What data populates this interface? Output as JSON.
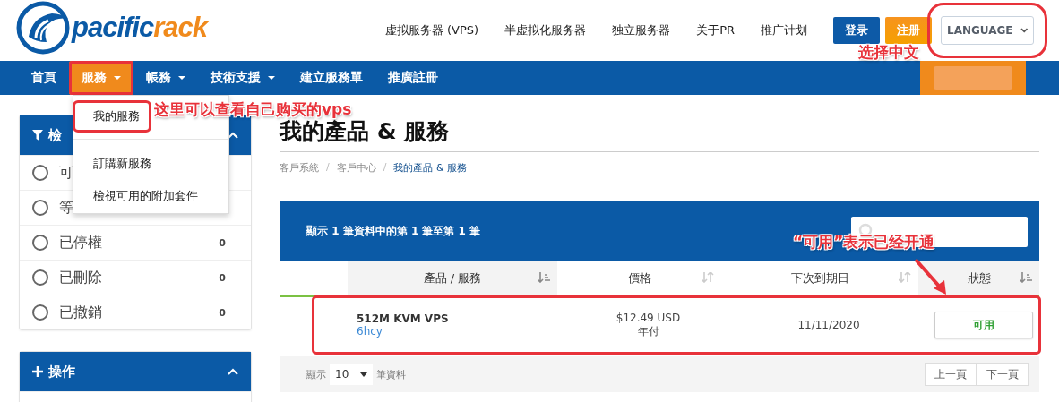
{
  "logo": {
    "part_1": "pacific",
    "part_2": "rack"
  },
  "top_links": [
    "虚拟服务器 (VPS)",
    "半虚拟化服务器",
    "独立服务器",
    "关于PR",
    "推广计划"
  ],
  "top_buttons": [
    {
      "label": "登录",
      "kind": "primary"
    },
    {
      "label": "注册",
      "kind": "warning"
    }
  ],
  "language_select": {
    "value": "LANGUAGE",
    "highlighted": true
  },
  "nav": {
    "items": [
      {
        "label": "首頁",
        "dropdown": false,
        "selected": false,
        "highlighted": false
      },
      {
        "label": "服務",
        "dropdown": true,
        "selected": true,
        "highlighted": true
      },
      {
        "label": "帳務",
        "dropdown": true,
        "selected": false,
        "highlighted": false
      },
      {
        "label": "技術支援",
        "dropdown": true,
        "selected": false,
        "highlighted": false
      },
      {
        "label": "建立服務單",
        "dropdown": false,
        "selected": false,
        "highlighted": false
      },
      {
        "label": "推廣註冊",
        "dropdown": false,
        "selected": false,
        "highlighted": false
      }
    ]
  },
  "dropdown_menu": {
    "items": [
      {
        "kind": "item",
        "label": "我的服務",
        "highlighted": true
      },
      {
        "kind": "divider"
      },
      {
        "kind": "item",
        "label": "訂購新服務",
        "highlighted": false
      },
      {
        "kind": "item",
        "label": "檢視可用的附加套件",
        "highlighted": false
      }
    ]
  },
  "sidebar": {
    "filter_panel": {
      "title": "檢",
      "items": [
        {
          "label": "可",
          "selected": false
        },
        {
          "label": "等",
          "selected": false
        },
        {
          "label": "已停權",
          "count": "0",
          "selected": false
        },
        {
          "label": "已刪除",
          "count": "0",
          "selected": false
        },
        {
          "label": "已撤銷",
          "count": "0",
          "selected": false
        }
      ]
    },
    "actions_panel": {
      "title": "操作"
    }
  },
  "main": {
    "title": "我的產品 & 服務",
    "breadcrumb": [
      {
        "kind": "link",
        "label": "客戶系統",
        "current": false
      },
      {
        "kind": "separator",
        "label": "/"
      },
      {
        "kind": "link",
        "label": "客戶中心",
        "current": false
      },
      {
        "kind": "separator",
        "label": "/"
      },
      {
        "kind": "link",
        "label": "我的產品 & 服務",
        "current": true
      }
    ],
    "table": {
      "info": "顯示 1 筆資料中的第 1 筆至第 1 筆",
      "columns": [
        {
          "label": "產品 / 服務",
          "sorted": true
        },
        {
          "label": "價格",
          "sorted": false
        },
        {
          "label": "下次到期日",
          "sorted": false
        },
        {
          "label": "狀態",
          "sorted": true
        }
      ],
      "rows": [
        {
          "product": "512M KVM VPS",
          "domain": "6hcy",
          "price": "$12.49 USD",
          "cycle": "年付",
          "due": "11/11/2020",
          "status": "可用",
          "highlighted": true
        }
      ],
      "footer": {
        "show_label": "顯示",
        "page_size": "10",
        "rows_label": "筆資料",
        "prev": "上一頁",
        "next": "下一頁"
      }
    }
  },
  "annotation_notes": [
    {
      "text": "这里可以查看自己购买的vps"
    },
    {
      "text": "选择中文"
    },
    {
      "text": "“可用”表示已经开通",
      "arrow": true
    }
  ]
}
